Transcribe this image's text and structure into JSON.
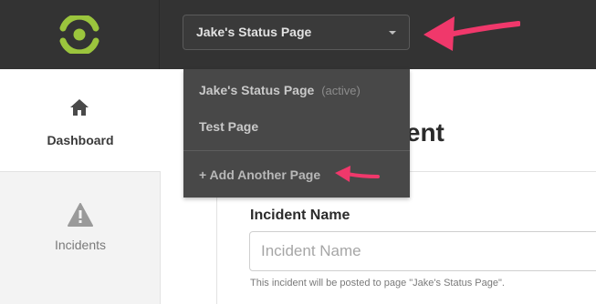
{
  "header": {
    "selected_page": "Jake's Status Page",
    "logo_icon": "statuspage-logo-icon",
    "caret_icon": "chevron-down-icon"
  },
  "dropdown": {
    "items": [
      {
        "label": "Jake's Status Page",
        "tag": "(active)"
      },
      {
        "label": "Test Page",
        "tag": ""
      }
    ],
    "add_label": "+ Add Another Page"
  },
  "sidebar": {
    "items": [
      {
        "label": "Dashboard",
        "icon": "home-icon"
      },
      {
        "label": "Incidents",
        "icon": "warning-icon"
      }
    ]
  },
  "main": {
    "heading": "ident",
    "field_label": "Incident Name",
    "field_placeholder": "Incident Name",
    "field_help": "This incident will be posted to page \"Jake's Status Page\"."
  },
  "colors": {
    "topbar": "#333333",
    "logo_green": "#9bc53d",
    "annotation_pink": "#f0386b",
    "dropdown_bg": "#484848"
  }
}
